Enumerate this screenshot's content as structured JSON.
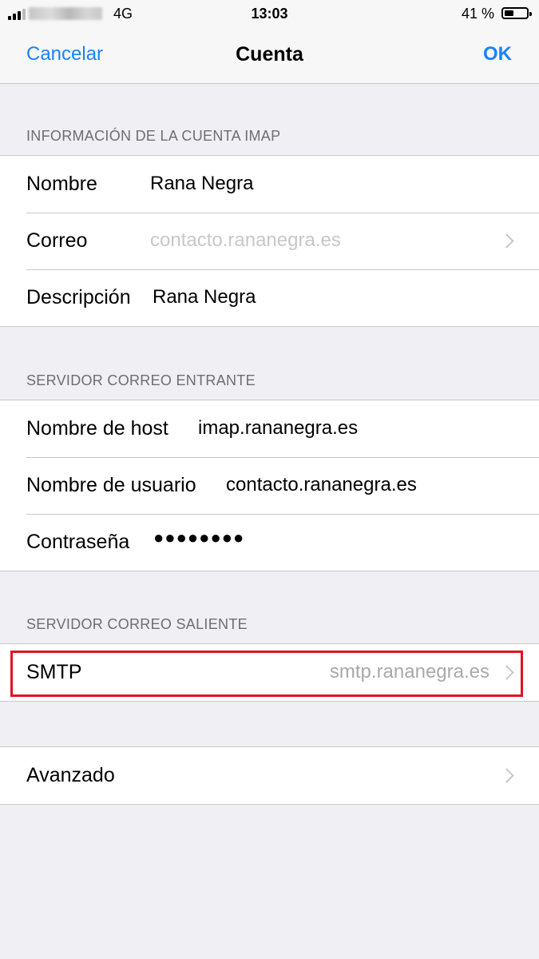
{
  "status_bar": {
    "network": "4G",
    "time": "13:03",
    "battery_percent": "41 %",
    "battery_level": 0.41
  },
  "nav": {
    "cancel_label": "Cancelar",
    "title": "Cuenta",
    "ok_label": "OK"
  },
  "imap_section": {
    "header": "INFORMACIÓN DE LA CUENTA IMAP",
    "name_label": "Nombre",
    "name_value": "Rana Negra",
    "email_label": "Correo",
    "email_value": "contacto.rananegra.es",
    "description_label": "Descripción",
    "description_value": "Rana Negra"
  },
  "incoming_section": {
    "header": "SERVIDOR CORREO ENTRANTE",
    "host_label": "Nombre de host",
    "host_value": "imap.rananegra.es",
    "user_label": "Nombre de usuario",
    "user_value": "contacto.rananegra.es",
    "password_label": "Contraseña",
    "password_value": "●●●●●●●●"
  },
  "outgoing_section": {
    "header": "SERVIDOR CORREO SALIENTE",
    "smtp_label": "SMTP",
    "smtp_value": "smtp.rananegra.es"
  },
  "advanced": {
    "label": "Avanzado"
  },
  "colors": {
    "accent": "#1a82fb",
    "highlight": "#e0141e",
    "background": "#efeff4"
  }
}
